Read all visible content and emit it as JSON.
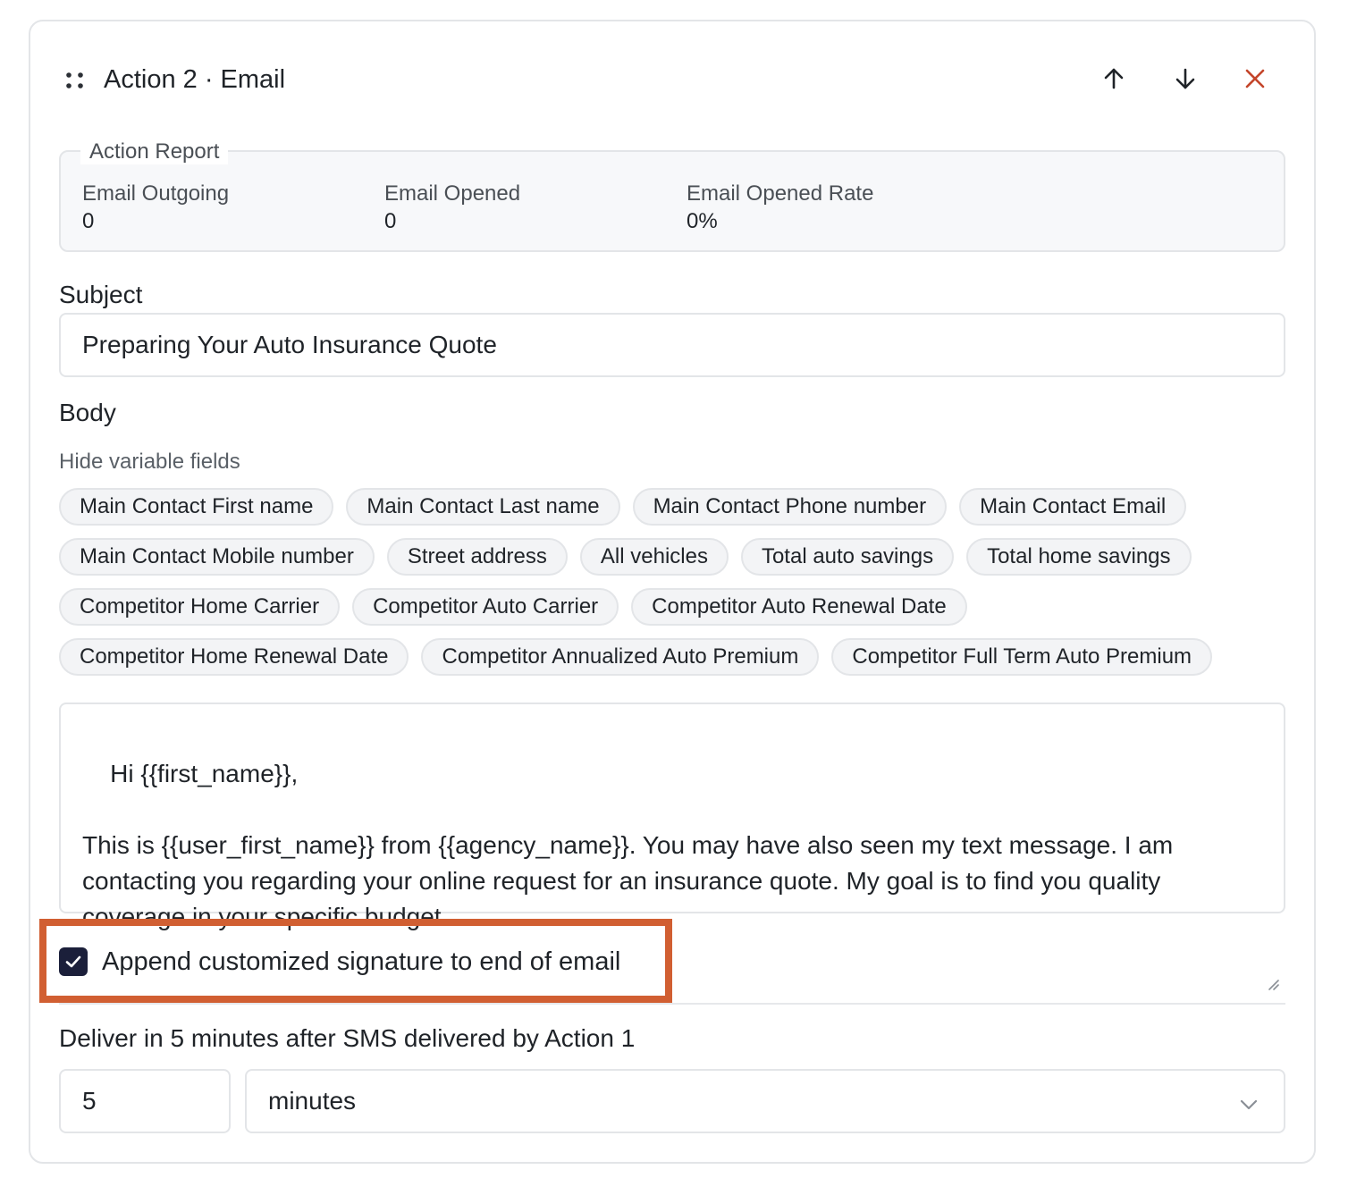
{
  "header": {
    "title": "Action 2 · Email",
    "icons": {
      "drag": "drag-handle-icon",
      "up": "arrow-up-icon",
      "down": "arrow-down-icon",
      "remove": "close-icon"
    },
    "close_color": "#c4452a"
  },
  "report": {
    "legend": "Action Report",
    "stats": [
      {
        "label": "Email Outgoing",
        "value": "0"
      },
      {
        "label": "Email Opened",
        "value": "0"
      },
      {
        "label": "Email Opened Rate",
        "value": "0%"
      }
    ]
  },
  "subject": {
    "label": "Subject",
    "value": "Preparing Your Auto Insurance Quote"
  },
  "body": {
    "label": "Body",
    "toggle_variables": "Hide variable fields",
    "variables": [
      "Main Contact First name",
      "Main Contact Last name",
      "Main Contact Phone number",
      "Main Contact Email",
      "Main Contact Mobile number",
      "Street address",
      "All vehicles",
      "Total auto savings",
      "Total home savings",
      "Competitor Home Carrier",
      "Competitor Auto Carrier",
      "Competitor Auto Renewal Date",
      "Competitor Home Renewal Date",
      "Competitor Annualized Auto Premium",
      "Competitor Full Term Auto Premium"
    ],
    "text": "Hi {{first_name}},\n\nThis is {{user_first_name}} from {{agency_name}}. You may have also seen my text message. I am contacting you regarding your online request for an insurance quote. My goal is to find you quality coverage in your specific budget."
  },
  "signature": {
    "label": "Append customized signature to end of email",
    "checked": true,
    "highlight_color": "#d15f32",
    "checkbox_color": "#1b1f3a"
  },
  "delivery": {
    "label": "Deliver in 5 minutes after SMS delivered by Action 1",
    "amount": "5",
    "unit": "minutes"
  }
}
